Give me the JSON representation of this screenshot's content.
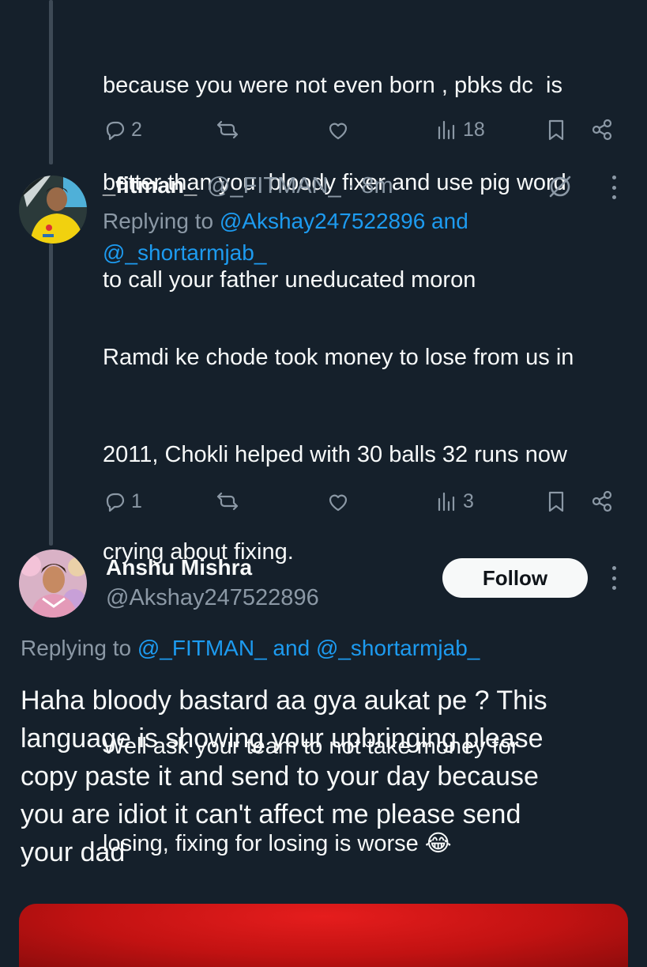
{
  "tweet1": {
    "text_lines": [
      "because you were not even born , pbks dc  is",
      "better than you  bloody fixer and use pig word",
      "to call your father uneducated moron"
    ],
    "replies": "2",
    "views": "18"
  },
  "tweet2": {
    "name": "_fitman_",
    "handle": "@_FITMAN_",
    "time": "· 8m",
    "replying_prefix": "Replying to ",
    "replying_user1": "@Akshay247522896",
    "replying_and": " and",
    "replying_user2": "@_shortarmjab_",
    "paragraph1_lines": [
      "Ramdi ke chode took money to lose from us in",
      "2011, Chokli helped with 30 balls 32 runs now",
      "crying about fixing."
    ],
    "paragraph2_lines": [
      "Well ask your team to not take money for",
      "losing, fixing for losing is worse 😂"
    ],
    "replies": "1",
    "views": "3"
  },
  "main_tweet": {
    "name": "Anshu Mishra",
    "handle": "@Akshay247522896",
    "follow_label": "Follow",
    "replying_prefix": "Replying to ",
    "replying_user1": "@_FITMAN_",
    "replying_and": " and ",
    "replying_user2": "@_shortarmjab_",
    "text_lines": [
      "Haha bloody bastard aa gya aukat pe ? This",
      "language is showing your upbringing please",
      "copy paste it and send to your day because",
      "you are idiot it can't affect me please send",
      "your dad"
    ]
  },
  "icons": {
    "reply": "reply-icon",
    "retweet": "retweet-icon",
    "like": "like-icon",
    "views": "views-icon",
    "bookmark": "bookmark-icon",
    "share": "share-icon",
    "grok": "grok-icon",
    "more": "more-icon"
  },
  "colors": {
    "background": "#15202b",
    "text": "#f7f9f9",
    "muted": "#8b98a5",
    "link": "#1d9bf0",
    "follow_bg": "#f7f9f9",
    "media_red": "#d81616"
  }
}
